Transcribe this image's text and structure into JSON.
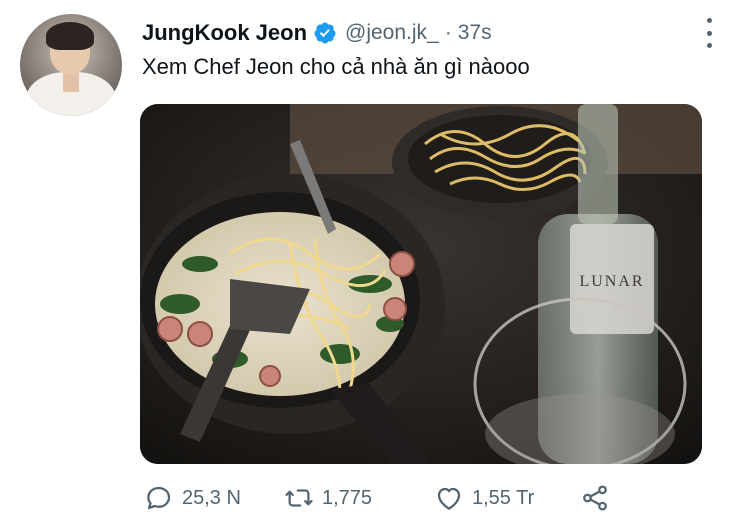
{
  "tweet": {
    "author_name": "JungKook Jeon",
    "handle": "@jeon.jk_",
    "separator": "·",
    "timestamp": "37s",
    "text": "Xem Chef Jeon cho cả nhà ăn gì nàooo",
    "verified": true,
    "accent_color": "#1d9bf0"
  },
  "media": {
    "bottle_label_text": "LUNAR"
  },
  "actions": {
    "reply_count": "25,3 N",
    "retweet_count": "1,775",
    "like_count": "1,55 Tr",
    "share_label": ""
  },
  "icons": [
    "comment-icon",
    "retweet-icon",
    "heart-icon",
    "share-icon",
    "more-icon",
    "verified-badge-icon"
  ]
}
